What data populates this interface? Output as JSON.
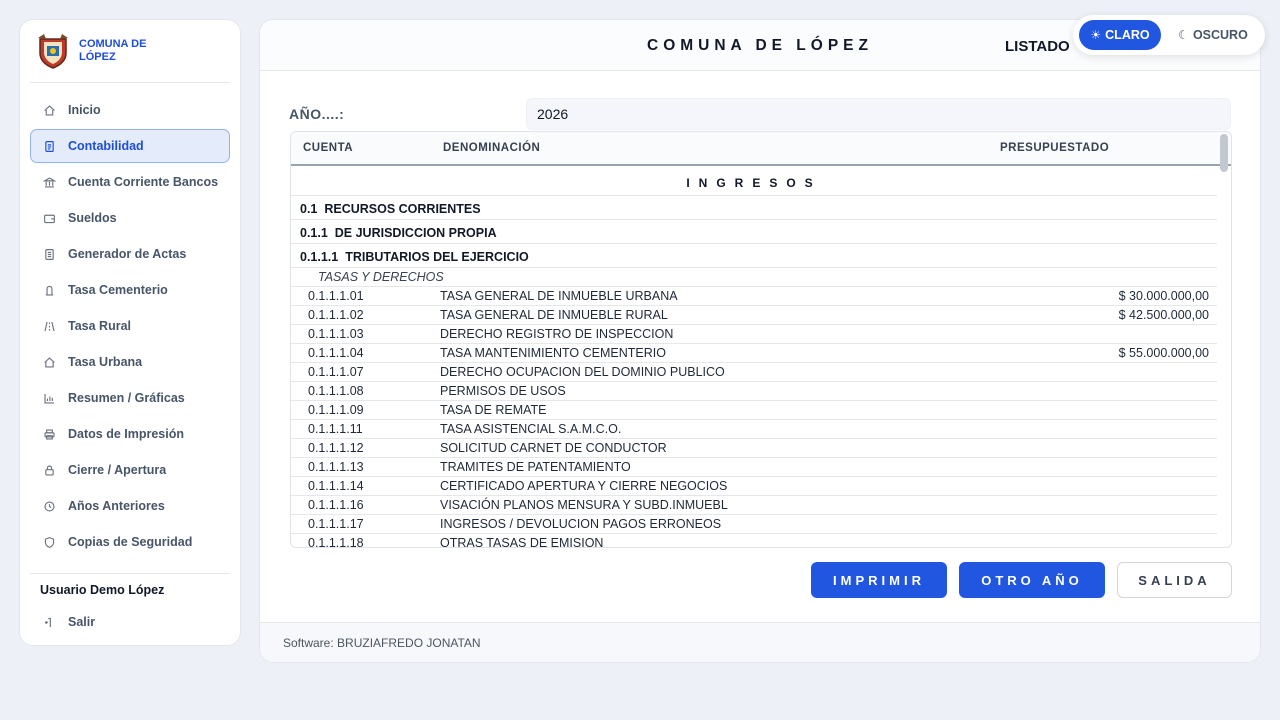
{
  "brand": {
    "name": "COMUNA DE LÓPEZ"
  },
  "sidebar": {
    "items": [
      {
        "label": "Inicio",
        "icon": "home-icon"
      },
      {
        "label": "Contabilidad",
        "icon": "document-icon",
        "active": true
      },
      {
        "label": "Cuenta Corriente Bancos",
        "icon": "bank-icon"
      },
      {
        "label": "Sueldos",
        "icon": "wallet-icon"
      },
      {
        "label": "Generador de Actas",
        "icon": "file-icon"
      },
      {
        "label": "Tasa Cementerio",
        "icon": "tombstone-icon"
      },
      {
        "label": "Tasa Rural",
        "icon": "road-icon"
      },
      {
        "label": "Tasa Urbana",
        "icon": "house-icon"
      },
      {
        "label": "Resumen / Gráficas",
        "icon": "chart-icon"
      },
      {
        "label": "Datos de Impresión",
        "icon": "printer-icon"
      },
      {
        "label": "Cierre / Apertura",
        "icon": "lock-icon"
      },
      {
        "label": "Años Anteriores",
        "icon": "clock-icon"
      },
      {
        "label": "Copias de Seguridad",
        "icon": "shield-icon"
      }
    ],
    "user": "Usuario Demo López",
    "logout": "Salir"
  },
  "header": {
    "title": "COMUNA DE LÓPEZ",
    "listado": "LISTADO"
  },
  "theme": {
    "claro": "CLARO",
    "oscuro": "OSCURO"
  },
  "year": {
    "label": "AÑO....:",
    "value": "2026"
  },
  "table": {
    "headers": {
      "cuenta": "CUENTA",
      "denominacion": "DENOMINACIÓN",
      "presupuestado": "PRESUPUESTADO"
    },
    "section": "INGRESOS",
    "groups": [
      {
        "code": "0.1",
        "name": "RECURSOS CORRIENTES"
      },
      {
        "code": "0.1.1",
        "name": "DE JURISDICCION PROPIA"
      },
      {
        "code": "0.1.1.1",
        "name": "TRIBUTARIOS DEL EJERCICIO"
      }
    ],
    "subheader": "TASAS Y DERECHOS",
    "rows": [
      {
        "code": "0.1.1.1.01",
        "name": "TASA GENERAL DE INMUEBLE URBANA",
        "amount": "$ 30.000.000,00"
      },
      {
        "code": "0.1.1.1.02",
        "name": "TASA GENERAL DE INMUEBLE RURAL",
        "amount": "$ 42.500.000,00"
      },
      {
        "code": "0.1.1.1.03",
        "name": "DERECHO REGISTRO DE INSPECCION",
        "amount": ""
      },
      {
        "code": "0.1.1.1.04",
        "name": "TASA MANTENIMIENTO CEMENTERIO",
        "amount": "$ 55.000.000,00"
      },
      {
        "code": "0.1.1.1.07",
        "name": "DERECHO OCUPACION DEL DOMINIO PUBLICO",
        "amount": ""
      },
      {
        "code": "0.1.1.1.08",
        "name": "PERMISOS DE USOS",
        "amount": ""
      },
      {
        "code": "0.1.1.1.09",
        "name": "TASA DE REMATE",
        "amount": ""
      },
      {
        "code": "0.1.1.1.11",
        "name": "TASA ASISTENCIAL S.A.M.C.O.",
        "amount": ""
      },
      {
        "code": "0.1.1.1.12",
        "name": "SOLICITUD CARNET DE CONDUCTOR",
        "amount": ""
      },
      {
        "code": "0.1.1.1.13",
        "name": "TRAMITES DE PATENTAMIENTO",
        "amount": ""
      },
      {
        "code": "0.1.1.1.14",
        "name": "CERTIFICADO APERTURA Y CIERRE NEGOCIOS",
        "amount": ""
      },
      {
        "code": "0.1.1.1.16",
        "name": "VISACIÓN PLANOS MENSURA Y SUBD.INMUEBL",
        "amount": ""
      },
      {
        "code": "0.1.1.1.17",
        "name": "INGRESOS / DEVOLUCION PAGOS ERRONEOS",
        "amount": ""
      },
      {
        "code": "0.1.1.1.18",
        "name": "OTRAS TASAS DE EMISION",
        "amount": ""
      }
    ]
  },
  "buttons": {
    "imprimir": "IMPRIMIR",
    "otro_anio": "OTRO AÑO",
    "salida": "SALIDA"
  },
  "footer": "Software: BRUZIAFREDO JONATAN",
  "colors": {
    "accent": "#2156e0",
    "active_bg": "#e4ecfb"
  }
}
